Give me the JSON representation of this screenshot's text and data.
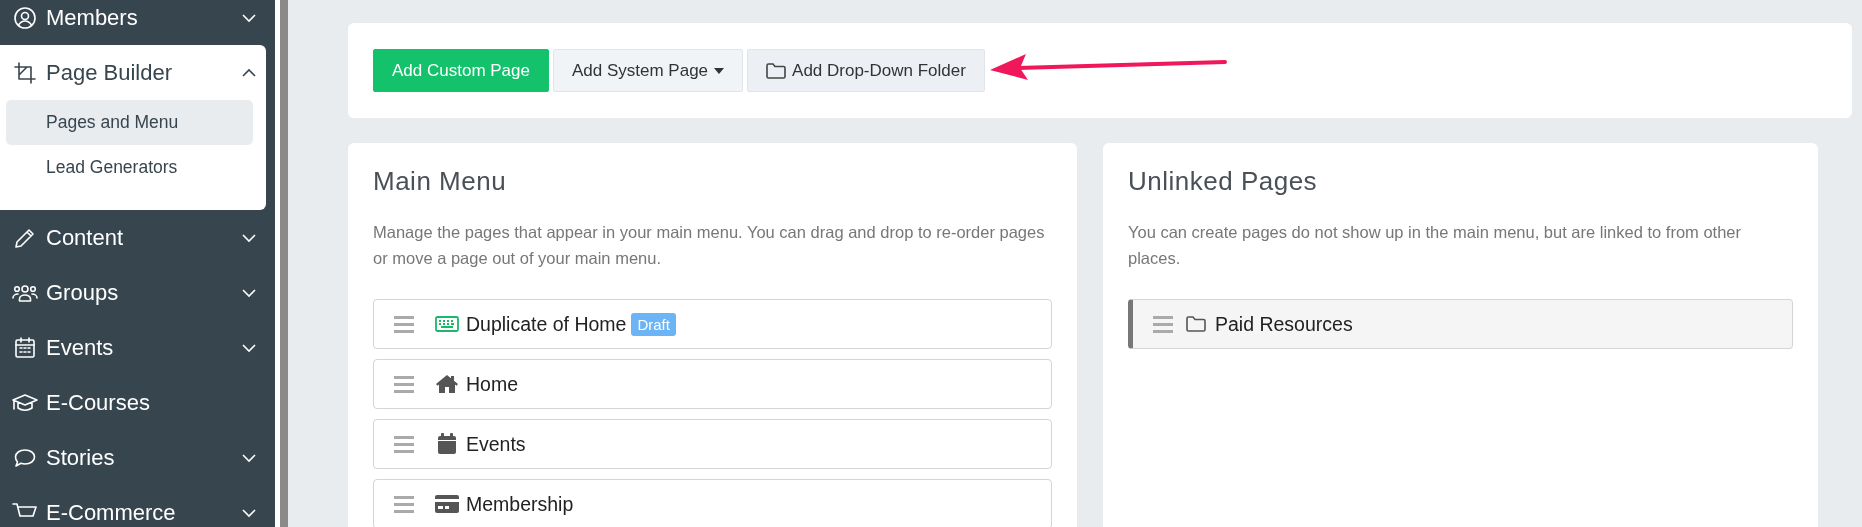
{
  "sidebar": {
    "items": [
      {
        "label": "Members",
        "expanded": false,
        "has_submenu": true
      },
      {
        "label": "Page Builder",
        "expanded": true,
        "has_submenu": true,
        "children": [
          {
            "label": "Pages and Menu",
            "selected": true
          },
          {
            "label": "Lead Generators",
            "selected": false
          }
        ]
      },
      {
        "label": "Content",
        "expanded": false,
        "has_submenu": true
      },
      {
        "label": "Groups",
        "expanded": false,
        "has_submenu": true
      },
      {
        "label": "Events",
        "expanded": false,
        "has_submenu": true
      },
      {
        "label": "E-Courses",
        "expanded": false,
        "has_submenu": false
      },
      {
        "label": "Stories",
        "expanded": false,
        "has_submenu": true
      },
      {
        "label": "E-Commerce",
        "expanded": false,
        "has_submenu": true
      }
    ]
  },
  "toolbar": {
    "buttons": [
      {
        "label": "Add Custom Page",
        "kind": "primary"
      },
      {
        "label": "Add System Page",
        "kind": "dropdown"
      },
      {
        "label": "Add Drop-Down Folder",
        "kind": "folder"
      }
    ]
  },
  "main_menu": {
    "title": "Main Menu",
    "description": "Manage the pages that appear in your main menu. You can drag and drop to re-order pages or move a page out of your main menu.",
    "pages": [
      {
        "label": "Duplicate of Home",
        "badge": "Draft"
      },
      {
        "label": "Home"
      },
      {
        "label": "Events"
      },
      {
        "label": "Membership"
      }
    ]
  },
  "unlinked_pages": {
    "title": "Unlinked Pages",
    "description": "You can create pages do not show up in the main menu, but are linked to from other places.",
    "pages": [
      {
        "label": "Paid Resources"
      }
    ]
  }
}
